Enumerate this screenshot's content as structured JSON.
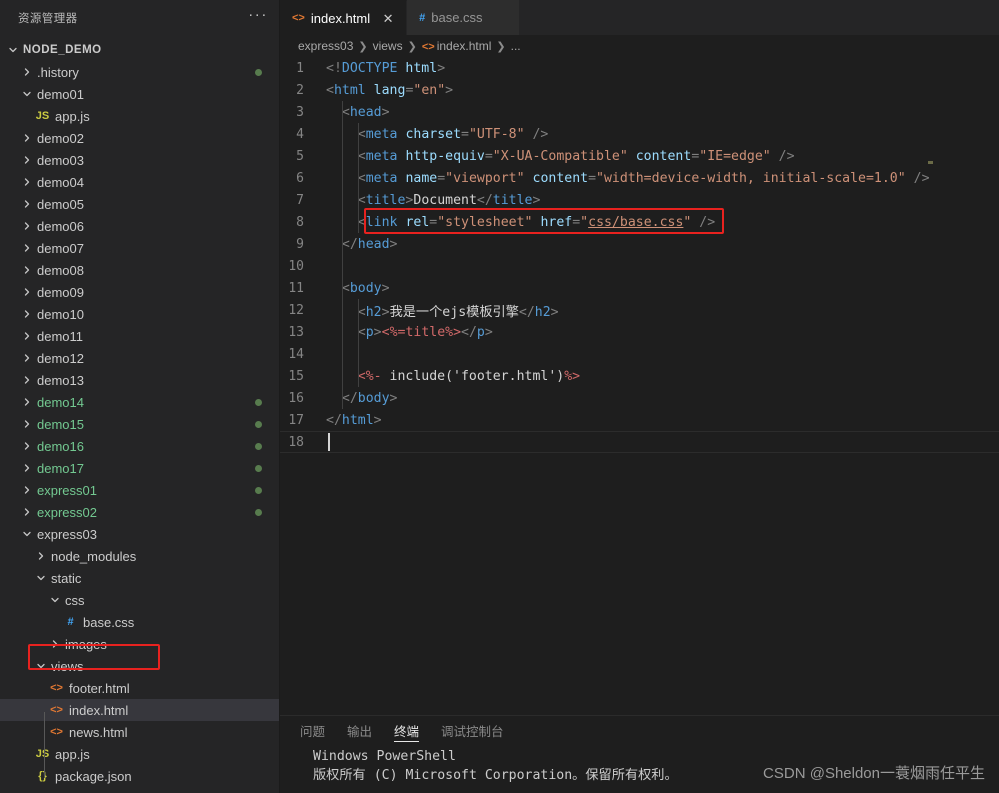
{
  "sidebar": {
    "title": "资源管理器",
    "more_label": "···",
    "root": {
      "label": "NODE_DEMO",
      "expanded": true
    },
    "items": [
      {
        "label": ".history",
        "type": "folder",
        "depth": 1,
        "expanded": false,
        "modified": true,
        "color": "normal"
      },
      {
        "label": "demo01",
        "type": "folder",
        "depth": 1,
        "expanded": true,
        "modified": false,
        "color": "normal"
      },
      {
        "label": "app.js",
        "type": "js",
        "depth": 2,
        "modified": false,
        "color": "normal"
      },
      {
        "label": "demo02",
        "type": "folder",
        "depth": 1,
        "expanded": false,
        "modified": false,
        "color": "normal"
      },
      {
        "label": "demo03",
        "type": "folder",
        "depth": 1,
        "expanded": false,
        "modified": false,
        "color": "normal"
      },
      {
        "label": "demo04",
        "type": "folder",
        "depth": 1,
        "expanded": false,
        "modified": false,
        "color": "normal"
      },
      {
        "label": "demo05",
        "type": "folder",
        "depth": 1,
        "expanded": false,
        "modified": false,
        "color": "normal"
      },
      {
        "label": "demo06",
        "type": "folder",
        "depth": 1,
        "expanded": false,
        "modified": false,
        "color": "normal"
      },
      {
        "label": "demo07",
        "type": "folder",
        "depth": 1,
        "expanded": false,
        "modified": false,
        "color": "normal"
      },
      {
        "label": "demo08",
        "type": "folder",
        "depth": 1,
        "expanded": false,
        "modified": false,
        "color": "normal"
      },
      {
        "label": "demo09",
        "type": "folder",
        "depth": 1,
        "expanded": false,
        "modified": false,
        "color": "normal"
      },
      {
        "label": "demo10",
        "type": "folder",
        "depth": 1,
        "expanded": false,
        "modified": false,
        "color": "normal"
      },
      {
        "label": "demo11",
        "type": "folder",
        "depth": 1,
        "expanded": false,
        "modified": false,
        "color": "normal"
      },
      {
        "label": "demo12",
        "type": "folder",
        "depth": 1,
        "expanded": false,
        "modified": false,
        "color": "normal"
      },
      {
        "label": "demo13",
        "type": "folder",
        "depth": 1,
        "expanded": false,
        "modified": false,
        "color": "normal"
      },
      {
        "label": "demo14",
        "type": "folder",
        "depth": 1,
        "expanded": false,
        "modified": true,
        "color": "green"
      },
      {
        "label": "demo15",
        "type": "folder",
        "depth": 1,
        "expanded": false,
        "modified": true,
        "color": "green"
      },
      {
        "label": "demo16",
        "type": "folder",
        "depth": 1,
        "expanded": false,
        "modified": true,
        "color": "green"
      },
      {
        "label": "demo17",
        "type": "folder",
        "depth": 1,
        "expanded": false,
        "modified": true,
        "color": "green"
      },
      {
        "label": "express01",
        "type": "folder",
        "depth": 1,
        "expanded": false,
        "modified": true,
        "color": "green"
      },
      {
        "label": "express02",
        "type": "folder",
        "depth": 1,
        "expanded": false,
        "modified": true,
        "color": "green"
      },
      {
        "label": "express03",
        "type": "folder",
        "depth": 1,
        "expanded": true,
        "modified": false,
        "color": "normal"
      },
      {
        "label": "node_modules",
        "type": "folder",
        "depth": 2,
        "expanded": false,
        "modified": false,
        "color": "normal"
      },
      {
        "label": "static",
        "type": "folder",
        "depth": 2,
        "expanded": true,
        "modified": false,
        "color": "normal"
      },
      {
        "label": "css",
        "type": "folder",
        "depth": 3,
        "expanded": true,
        "modified": false,
        "color": "normal"
      },
      {
        "label": "base.css",
        "type": "css",
        "depth": 4,
        "modified": false,
        "color": "normal",
        "highlight": true
      },
      {
        "label": "images",
        "type": "folder",
        "depth": 3,
        "expanded": false,
        "modified": false,
        "color": "normal"
      },
      {
        "label": "views",
        "type": "folder",
        "depth": 2,
        "expanded": true,
        "modified": false,
        "color": "normal"
      },
      {
        "label": "footer.html",
        "type": "html",
        "depth": 3,
        "modified": false,
        "color": "normal"
      },
      {
        "label": "index.html",
        "type": "html",
        "depth": 3,
        "modified": false,
        "color": "normal",
        "selected": true
      },
      {
        "label": "news.html",
        "type": "html",
        "depth": 3,
        "modified": false,
        "color": "normal"
      },
      {
        "label": "app.js",
        "type": "js",
        "depth": 2,
        "modified": false,
        "color": "normal"
      },
      {
        "label": "package.json",
        "type": "json",
        "depth": 2,
        "modified": false,
        "color": "normal"
      }
    ]
  },
  "tabs": [
    {
      "label": "index.html",
      "icon": "html-icon",
      "glyph": "<>",
      "active": true,
      "closable": true,
      "close_glyph": "✕"
    },
    {
      "label": "base.css",
      "icon": "css-icon",
      "glyph": "#",
      "active": false,
      "closable": false,
      "close_glyph": ""
    }
  ],
  "breadcrumb": {
    "parts": [
      "express03",
      "views",
      "index.html",
      "..."
    ],
    "separator": "❯",
    "file_glyph": "<>"
  },
  "editor": {
    "file": "index.html",
    "cursor_line": 18,
    "highlight_line": 8,
    "lines": [
      {
        "n": 1,
        "tokens": [
          {
            "c": "t-brk",
            "t": "<!"
          },
          {
            "c": "t-doct",
            "t": "DOCTYPE"
          },
          {
            "c": "t-plain",
            "t": " "
          },
          {
            "c": "t-attr",
            "t": "html"
          },
          {
            "c": "t-brk",
            "t": ">"
          }
        ]
      },
      {
        "n": 2,
        "tokens": [
          {
            "c": "t-brk",
            "t": "<"
          },
          {
            "c": "t-tag",
            "t": "html"
          },
          {
            "c": "t-plain",
            "t": " "
          },
          {
            "c": "t-attr",
            "t": "lang"
          },
          {
            "c": "t-brk",
            "t": "="
          },
          {
            "c": "t-str",
            "t": "\"en\""
          },
          {
            "c": "t-brk",
            "t": ">"
          }
        ]
      },
      {
        "n": 3,
        "indent": 1,
        "tokens": [
          {
            "c": "t-brk",
            "t": "<"
          },
          {
            "c": "t-tag",
            "t": "head"
          },
          {
            "c": "t-brk",
            "t": ">"
          }
        ]
      },
      {
        "n": 4,
        "indent": 2,
        "tokens": [
          {
            "c": "t-brk",
            "t": "<"
          },
          {
            "c": "t-tag",
            "t": "meta"
          },
          {
            "c": "t-plain",
            "t": " "
          },
          {
            "c": "t-attr",
            "t": "charset"
          },
          {
            "c": "t-brk",
            "t": "="
          },
          {
            "c": "t-str",
            "t": "\"UTF-8\""
          },
          {
            "c": "t-brk",
            "t": " />"
          }
        ]
      },
      {
        "n": 5,
        "indent": 2,
        "tokens": [
          {
            "c": "t-brk",
            "t": "<"
          },
          {
            "c": "t-tag",
            "t": "meta"
          },
          {
            "c": "t-plain",
            "t": " "
          },
          {
            "c": "t-attr",
            "t": "http-equiv"
          },
          {
            "c": "t-brk",
            "t": "="
          },
          {
            "c": "t-str",
            "t": "\"X-UA-Compatible\""
          },
          {
            "c": "t-plain",
            "t": " "
          },
          {
            "c": "t-attr",
            "t": "content"
          },
          {
            "c": "t-brk",
            "t": "="
          },
          {
            "c": "t-str",
            "t": "\"IE=edge\""
          },
          {
            "c": "t-brk",
            "t": " />"
          }
        ]
      },
      {
        "n": 6,
        "indent": 2,
        "tokens": [
          {
            "c": "t-brk",
            "t": "<"
          },
          {
            "c": "t-tag",
            "t": "meta"
          },
          {
            "c": "t-plain",
            "t": " "
          },
          {
            "c": "t-attr",
            "t": "name"
          },
          {
            "c": "t-brk",
            "t": "="
          },
          {
            "c": "t-str",
            "t": "\"viewport\""
          },
          {
            "c": "t-plain",
            "t": " "
          },
          {
            "c": "t-attr",
            "t": "content"
          },
          {
            "c": "t-brk",
            "t": "="
          },
          {
            "c": "t-str",
            "t": "\"width=device-width, initial-scale=1.0\""
          },
          {
            "c": "t-brk",
            "t": " />"
          }
        ]
      },
      {
        "n": 7,
        "indent": 2,
        "tokens": [
          {
            "c": "t-brk",
            "t": "<"
          },
          {
            "c": "t-tag",
            "t": "title"
          },
          {
            "c": "t-brk",
            "t": ">"
          },
          {
            "c": "t-txt",
            "t": "Document"
          },
          {
            "c": "t-brk",
            "t": "</"
          },
          {
            "c": "t-tag",
            "t": "title"
          },
          {
            "c": "t-brk",
            "t": ">"
          }
        ]
      },
      {
        "n": 8,
        "indent": 2,
        "tokens": [
          {
            "c": "t-brk",
            "t": "<"
          },
          {
            "c": "t-tag",
            "t": "link"
          },
          {
            "c": "t-plain",
            "t": " "
          },
          {
            "c": "t-attr",
            "t": "rel"
          },
          {
            "c": "t-brk",
            "t": "="
          },
          {
            "c": "t-str",
            "t": "\"stylesheet\""
          },
          {
            "c": "t-plain",
            "t": " "
          },
          {
            "c": "t-attr",
            "t": "href"
          },
          {
            "c": "t-brk",
            "t": "="
          },
          {
            "c": "t-str",
            "t": "\""
          },
          {
            "c": "t-link",
            "t": "css/base.css"
          },
          {
            "c": "t-str",
            "t": "\""
          },
          {
            "c": "t-brk",
            "t": " />"
          }
        ]
      },
      {
        "n": 9,
        "indent": 1,
        "tokens": [
          {
            "c": "t-brk",
            "t": "</"
          },
          {
            "c": "t-tag",
            "t": "head"
          },
          {
            "c": "t-brk",
            "t": ">"
          }
        ]
      },
      {
        "n": 10,
        "indent": 1,
        "tokens": []
      },
      {
        "n": 11,
        "indent": 1,
        "tokens": [
          {
            "c": "t-brk",
            "t": "<"
          },
          {
            "c": "t-tag",
            "t": "body"
          },
          {
            "c": "t-brk",
            "t": ">"
          }
        ]
      },
      {
        "n": 12,
        "indent": 2,
        "tokens": [
          {
            "c": "t-brk",
            "t": "<"
          },
          {
            "c": "t-tag",
            "t": "h2"
          },
          {
            "c": "t-brk",
            "t": ">"
          },
          {
            "c": "t-txt",
            "t": "我是一个ejs模板引擎"
          },
          {
            "c": "t-brk",
            "t": "</"
          },
          {
            "c": "t-tag",
            "t": "h2"
          },
          {
            "c": "t-brk",
            "t": ">"
          }
        ]
      },
      {
        "n": 13,
        "indent": 2,
        "tokens": [
          {
            "c": "t-brk",
            "t": "<"
          },
          {
            "c": "t-tag",
            "t": "p"
          },
          {
            "c": "t-brk",
            "t": ">"
          },
          {
            "c": "t-ejs",
            "t": "<%=title%>"
          },
          {
            "c": "t-brk",
            "t": "</"
          },
          {
            "c": "t-tag",
            "t": "p"
          },
          {
            "c": "t-brk",
            "t": ">"
          }
        ]
      },
      {
        "n": 14,
        "indent": 2,
        "tokens": []
      },
      {
        "n": 15,
        "indent": 2,
        "tokens": [
          {
            "c": "t-ejs",
            "t": "<%-"
          },
          {
            "c": "t-txt",
            "t": " include('footer.html')"
          },
          {
            "c": "t-ejs",
            "t": "%>"
          }
        ]
      },
      {
        "n": 16,
        "indent": 1,
        "tokens": [
          {
            "c": "t-brk",
            "t": "</"
          },
          {
            "c": "t-tag",
            "t": "body"
          },
          {
            "c": "t-brk",
            "t": ">"
          }
        ]
      },
      {
        "n": 17,
        "tokens": [
          {
            "c": "t-brk",
            "t": "</"
          },
          {
            "c": "t-tag",
            "t": "html"
          },
          {
            "c": "t-brk",
            "t": ">"
          }
        ]
      },
      {
        "n": 18,
        "tokens": [],
        "current": true
      }
    ]
  },
  "panel": {
    "tabs": [
      {
        "label": "问题",
        "active": false
      },
      {
        "label": "输出",
        "active": false
      },
      {
        "label": "终端",
        "active": true
      },
      {
        "label": "调试控制台",
        "active": false
      }
    ],
    "terminal_lines": [
      "Windows PowerShell",
      "版权所有 (C) Microsoft Corporation。保留所有权利。"
    ]
  },
  "watermark": "CSDN @Sheldon一蓑烟雨任平生",
  "colors": {
    "sidebar_bg": "#252526",
    "editor_bg": "#1e1e1e",
    "tab_active_bg": "#1e1e1e",
    "tab_inactive_bg": "#2d2d2d",
    "selection_bg": "#37373d",
    "modified_green": "#73c991",
    "dot_green": "#587c4e",
    "highlight_red": "#e8221f",
    "html_icon": "#e37933",
    "css_icon": "#42a5f5",
    "js_icon": "#cbcb41"
  }
}
